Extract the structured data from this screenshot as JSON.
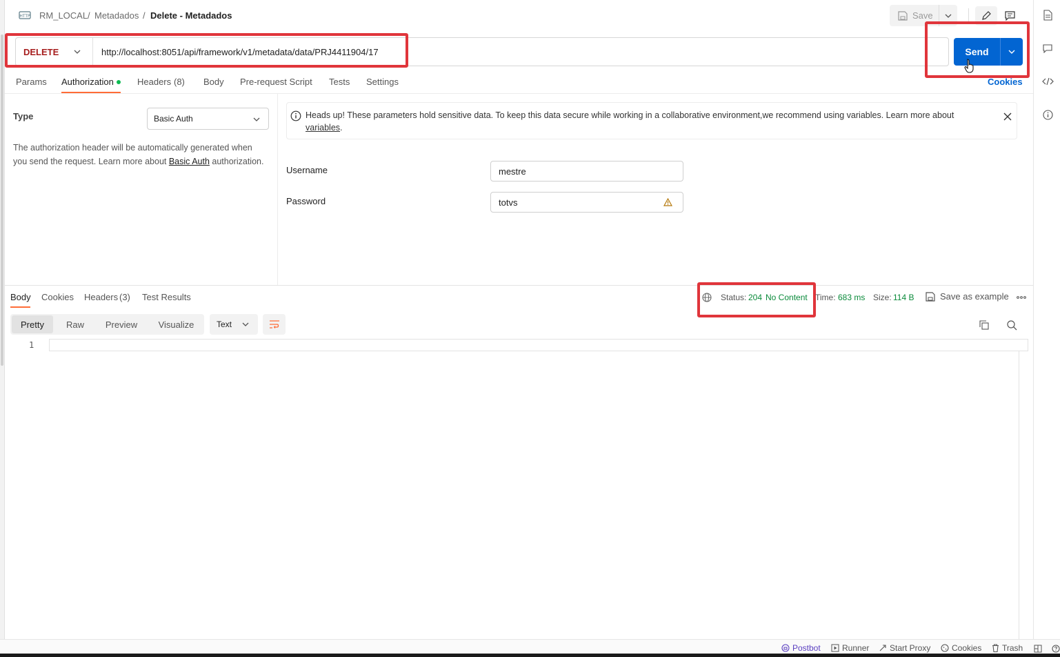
{
  "breadcrumb": {
    "workspace": "RM_LOCAL",
    "sep1": "/",
    "collection": "Metadados",
    "sep2": "/",
    "request": "Delete - Metadados"
  },
  "toolbar": {
    "save_label": "Save",
    "send_label": "Send"
  },
  "request": {
    "method": "DELETE",
    "url": "http://localhost:8051/api/framework/v1/metadata/data/PRJ4411904/17"
  },
  "request_tabs": {
    "params": "Params",
    "authorization": "Authorization",
    "headers": "Headers",
    "headers_count": "(8)",
    "body": "Body",
    "prerequest": "Pre-request Script",
    "tests": "Tests",
    "settings": "Settings",
    "cookies": "Cookies"
  },
  "auth": {
    "type_label": "Type",
    "type_value": "Basic Auth",
    "help_text": "The authorization header will be automatically generated when you send the request. Learn more about ",
    "help_link": "Basic Auth",
    "help_suffix": " authorization.",
    "banner_text": "Heads up! These parameters hold sensitive data. To keep this data secure while working in a collaborative environment,we recommend using variables. Learn more about ",
    "banner_link": "variables",
    "banner_suffix": ".",
    "username_label": "Username",
    "username_value": "mestre",
    "password_label": "Password",
    "password_value": "totvs"
  },
  "response": {
    "tabs": {
      "body": "Body",
      "cookies": "Cookies",
      "headers": "Headers",
      "headers_count": "(3)",
      "test_results": "Test Results"
    },
    "status_label": "Status:",
    "status_code": "204",
    "status_text": "No Content",
    "time_label": "Time:",
    "time_value": "683 ms",
    "size_label": "Size:",
    "size_value": "114 B",
    "save_example": "Save as example",
    "views": [
      "Pretty",
      "Raw",
      "Preview",
      "Visualize"
    ],
    "format": "Text",
    "line_number": "1"
  },
  "footer": {
    "postbot": "Postbot",
    "runner": "Runner",
    "start_proxy": "Start Proxy",
    "cookies": "Cookies",
    "trash": "Trash"
  },
  "colors": {
    "send_blue": "#0265d2",
    "method_red": "#a61c1c",
    "status_green": "#0a8a3a",
    "active_tab_orange": "#ff6c37",
    "highlight_red": "#e0353b"
  }
}
